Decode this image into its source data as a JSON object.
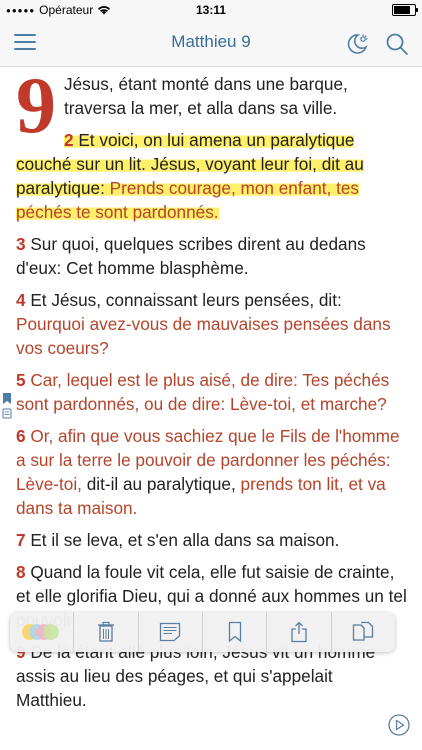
{
  "status": {
    "carrier": "Opérateur",
    "time": "13:11",
    "battery_level": 0.85
  },
  "nav": {
    "title": "Matthieu 9"
  },
  "chapter": {
    "number": "9",
    "verses": [
      {
        "num": "",
        "segments": [
          {
            "text": "Jésus, étant monté dans une barque, traversa la mer, et alla dans sa ville.",
            "red": false
          }
        ]
      },
      {
        "num": "2",
        "highlight": true,
        "segments": [
          {
            "text": "Et voici, on lui amena un paralytique couché sur un lit. Jésus, voyant leur foi, dit au paralytique: ",
            "red": false
          },
          {
            "text": "Prends courage, mon enfant, tes péchés te sont pardonnés.",
            "red": true
          }
        ]
      },
      {
        "num": "3",
        "segments": [
          {
            "text": "Sur quoi, quelques scribes dirent au dedans d'eux: Cet homme blasphème.",
            "red": false
          }
        ]
      },
      {
        "num": "4",
        "segments": [
          {
            "text": "Et Jésus, connaissant leurs pensées, dit: ",
            "red": false
          },
          {
            "text": "Pourquoi avez-vous de mauvaises pensées dans vos coeurs?",
            "red": true
          }
        ]
      },
      {
        "num": "5",
        "segments": [
          {
            "text": "Car, lequel est le plus aisé, de dire: Tes péchés sont pardonnés, ou de dire: Lève-toi, et marche?",
            "red": true
          }
        ]
      },
      {
        "num": "6",
        "segments": [
          {
            "text": "Or, afin que vous sachiez que le Fils de l'homme a sur la terre le pouvoir de pardonner les péchés: Lève-toi,",
            "red": true
          },
          {
            "text": " dit-il au paralytique, ",
            "red": false
          },
          {
            "text": "prends ton lit, et va dans ta maison.",
            "red": true
          }
        ]
      },
      {
        "num": "7",
        "segments": [
          {
            "text": "Et il se leva, et s'en alla dans sa maison.",
            "red": false
          }
        ]
      },
      {
        "num": "8",
        "segments": [
          {
            "text": "Quand la foule vit cela, elle fut saisie de crainte, et elle glorifia Dieu, qui a donné aux hommes un tel pouvoir.",
            "red": false
          }
        ]
      },
      {
        "num": "9",
        "segments": [
          {
            "text": "De là étant allé plus loin, Jésus vit un homme assis au lieu des péages, et qui s'appelait Matthieu.",
            "red": false
          }
        ]
      }
    ]
  },
  "toolbar": {
    "highlight_colors": [
      "#f9d25c",
      "#a7d8f0",
      "#f5b3c8",
      "#c8e6a0"
    ],
    "icons": [
      "highlight-colors-icon",
      "trash-icon",
      "note-icon",
      "bookmark-icon",
      "share-icon",
      "copy-icon"
    ]
  },
  "accent_color": "#4d7ea8",
  "verse_number_color": "#c0392b"
}
